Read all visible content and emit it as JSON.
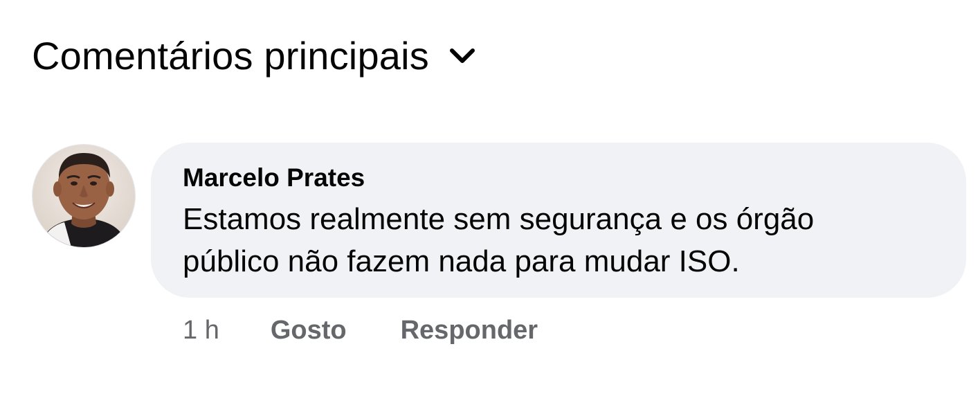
{
  "sort": {
    "label": "Comentários principais",
    "icon": "chevron-down-icon"
  },
  "comment": {
    "author": "Marcelo Prates",
    "text": "Estamos realmente sem segurança e os órgão público não fazem nada para mudar ISO.",
    "time": "1 h",
    "like_label": "Gosto",
    "reply_label": "Responder",
    "avatar_icon": "user-avatar"
  },
  "colors": {
    "bubble_bg": "#f0f2f5",
    "text": "#050505",
    "secondary_text": "#65676b"
  }
}
